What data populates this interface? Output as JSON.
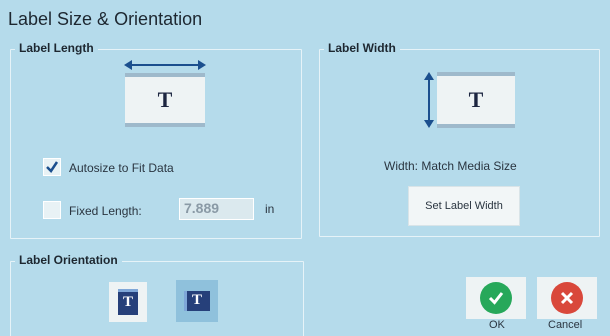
{
  "dialog": {
    "title": "Label Size & Orientation"
  },
  "label_length": {
    "group_label": "Label Length",
    "preview_letter": "T",
    "autosize": {
      "label": "Autosize to Fit Data",
      "checked": true
    },
    "fixed_length": {
      "label": "Fixed Length:",
      "checked": false,
      "value": "7.889",
      "unit": "in"
    }
  },
  "label_width": {
    "group_label": "Label Width",
    "preview_letter": "T",
    "width_text": "Width:  Match Media Size",
    "set_button": "Set Label Width"
  },
  "orientation": {
    "group_label": "Label Orientation",
    "options": [
      {
        "letter": "T",
        "icon": "portrait-orientation-icon",
        "selected": false
      },
      {
        "letter": "T",
        "icon": "landscape-orientation-icon",
        "selected": true
      }
    ]
  },
  "actions": {
    "ok_label": "OK",
    "cancel_label": "Cancel"
  },
  "colors": {
    "background": "#b5dbeb",
    "accent_blue": "#1b4f8e",
    "ok_green": "#27a85a",
    "cancel_red": "#d9483b"
  }
}
